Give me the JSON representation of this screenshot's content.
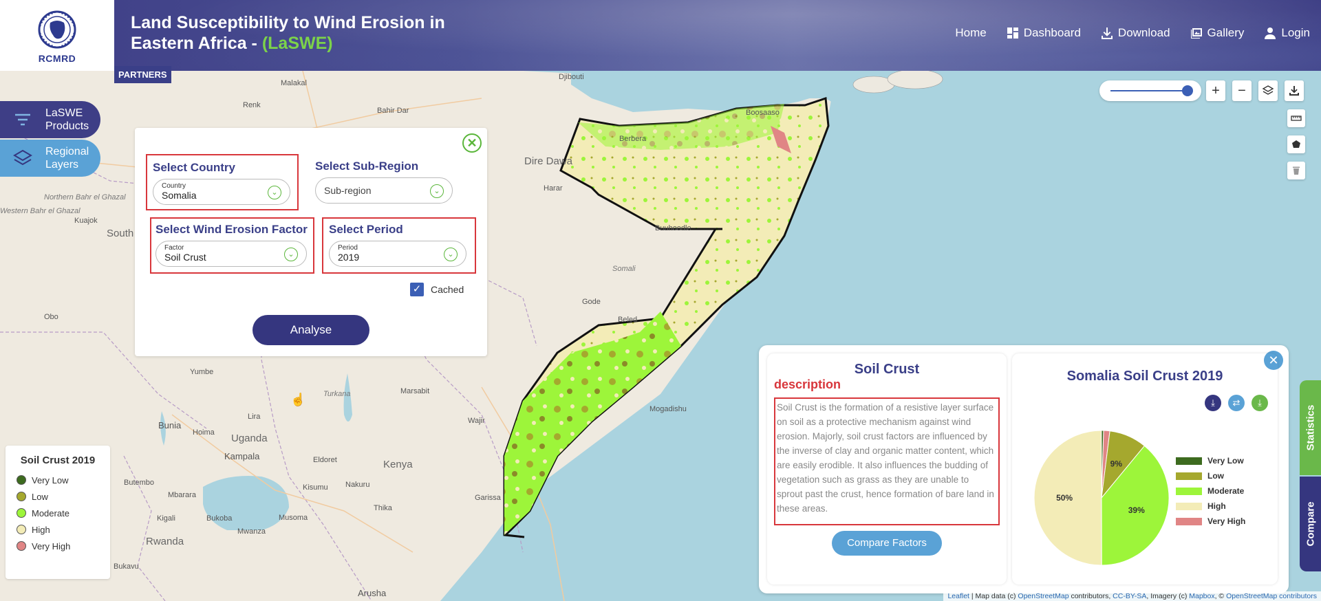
{
  "header": {
    "logo_text": "RCMRD",
    "title_main": "Land Susceptibility to Wind Erosion in Eastern Africa - ",
    "title_accent": "(LaSWE)",
    "nav": [
      {
        "label": "Home",
        "icon": "home"
      },
      {
        "label": "Dashboard",
        "icon": "dashboard-icon"
      },
      {
        "label": "Download",
        "icon": "download-icon"
      },
      {
        "label": "Gallery",
        "icon": "gallery-icon"
      },
      {
        "label": "Login",
        "icon": "user-icon"
      }
    ],
    "partners": "PARTNERS"
  },
  "side_buttons": {
    "products": "LaSWE Products",
    "layers": "Regional Layers"
  },
  "analysis_panel": {
    "country": {
      "title": "Select Country",
      "label": "Country",
      "value": "Somalia"
    },
    "subregion": {
      "title": "Select Sub-Region",
      "placeholder": "Sub-region"
    },
    "factor": {
      "title": "Select Wind Erosion Factor",
      "label": "Factor",
      "value": "Soil Crust"
    },
    "period": {
      "title": "Select Period",
      "label": "Period",
      "value": "2019"
    },
    "cached_label": "Cached",
    "cached_checked": true,
    "analyse_label": "Analyse"
  },
  "map_labels": {
    "cities": [
      "Djibouti",
      "Berbera",
      "Boosaaso",
      "Dire Dawa",
      "Harar",
      "Buuhoodle",
      "Gode",
      "Beled",
      "Yumbe",
      "Turkana",
      "Marsabit",
      "Wajir",
      "Bunia",
      "Hoima",
      "Uganda",
      "Lira",
      "Kampala",
      "Eldoret",
      "Kenya",
      "Garissa",
      "Mbarara",
      "Kigali",
      "Rwanda",
      "Mwanza",
      "Musoma",
      "Thika",
      "Arusha",
      "Bukavu",
      "Bukoba",
      "Bahir Dar",
      "Renk",
      "Kuajok",
      "Obo",
      "Malakal",
      "Butembo",
      "Kisumu",
      "Nakuru",
      "Mogadishu"
    ],
    "region_labels": [
      "Western Bahr el Ghazal",
      "Northern Bahr el Ghazal",
      "Somali",
      "South Sudan"
    ]
  },
  "stats_panel": {
    "desc_title": "Soil Crust",
    "desc_subtitle": "description",
    "description": "Soil Crust is the formation of a resistive layer surface on soil as a protective mechanism against wind erosion. Majorly, soil crust factors are influenced by the inverse of clay and organic matter content, which are easily erodible. It also influences the budding of vegetation such as grass as they are unable to sprout past the crust, hence formation of bare land in these areas.",
    "compare_label": "Compare Factors",
    "chart_title": "Somalia Soil Crust 2019"
  },
  "chart_data": {
    "type": "pie",
    "title": "Somalia Soil Crust 2019",
    "categories": [
      "Very Low",
      "Low",
      "Moderate",
      "High",
      "Very High"
    ],
    "values": [
      0.5,
      9,
      39,
      50,
      1.5
    ],
    "slice_labels": [
      "",
      "9%",
      "39%",
      "50%",
      ""
    ],
    "colors": [
      "#3d6b1f",
      "#a5a82e",
      "#9df53a",
      "#f3ecb7",
      "#e08585"
    ],
    "legend_position": "right"
  },
  "legend": {
    "title": "Soil Crust 2019",
    "items": [
      {
        "label": "Very Low",
        "color": "#3d6b1f"
      },
      {
        "label": "Low",
        "color": "#a5a82e"
      },
      {
        "label": "Moderate",
        "color": "#9df53a"
      },
      {
        "label": "High",
        "color": "#f3ecb7"
      },
      {
        "label": "Very High",
        "color": "#e08585"
      }
    ]
  },
  "right_tabs": {
    "statistics": "Statistics",
    "compare": "Compare"
  },
  "attribution": {
    "leaflet": "Leaflet",
    "text1": " | Map data (c) ",
    "osm": "OpenStreetMap",
    "text2": " contributors, ",
    "license": "CC-BY-SA",
    "text3": ", Imagery (c) ",
    "mapbox": "Mapbox",
    "text4": ", © ",
    "osm2": "OpenStreetMap contributors"
  }
}
